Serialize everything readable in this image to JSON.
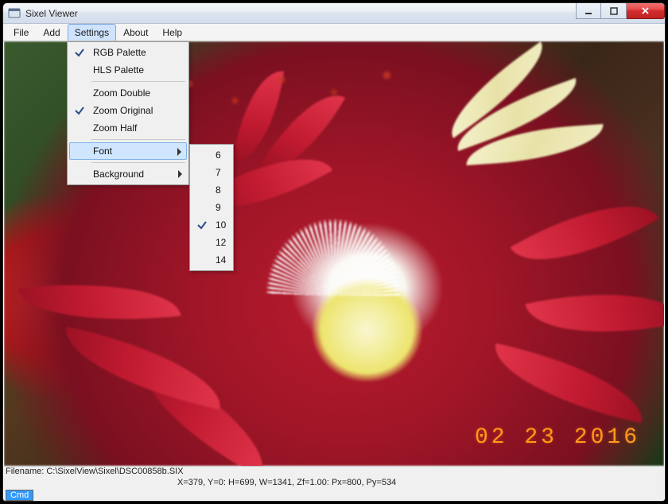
{
  "window": {
    "title": "Sixel Viewer"
  },
  "menubar": [
    "File",
    "Add",
    "Settings",
    "About",
    "Help"
  ],
  "menubar_open_index": 2,
  "settings_menu": {
    "groups": [
      [
        {
          "label": "RGB Palette",
          "checked": true
        },
        {
          "label": "HLS Palette",
          "checked": false
        }
      ],
      [
        {
          "label": "Zoom Double",
          "checked": false
        },
        {
          "label": "Zoom Original",
          "checked": true
        },
        {
          "label": "Zoom Half",
          "checked": false
        }
      ],
      [
        {
          "label": "Font",
          "submenu": true,
          "highlighted": true
        },
        {
          "label": "Background",
          "submenu": true
        }
      ]
    ]
  },
  "font_submenu": {
    "items": [
      {
        "label": "6",
        "checked": false
      },
      {
        "label": "7",
        "checked": false
      },
      {
        "label": "8",
        "checked": false
      },
      {
        "label": "9",
        "checked": false
      },
      {
        "label": "10",
        "checked": true
      },
      {
        "label": "12",
        "checked": false
      },
      {
        "label": "14",
        "checked": false
      }
    ]
  },
  "image": {
    "datestamp": "02  23  2016"
  },
  "status": {
    "filename_label": "Filename: C:\\SixelView\\Sixel\\DSC00858b.SIX",
    "coords": "X=379,  Y=0:  H=699,  W=1341,  Zf=1.00:  Px=800,  Py=534",
    "cmd_label": "Cmd"
  }
}
